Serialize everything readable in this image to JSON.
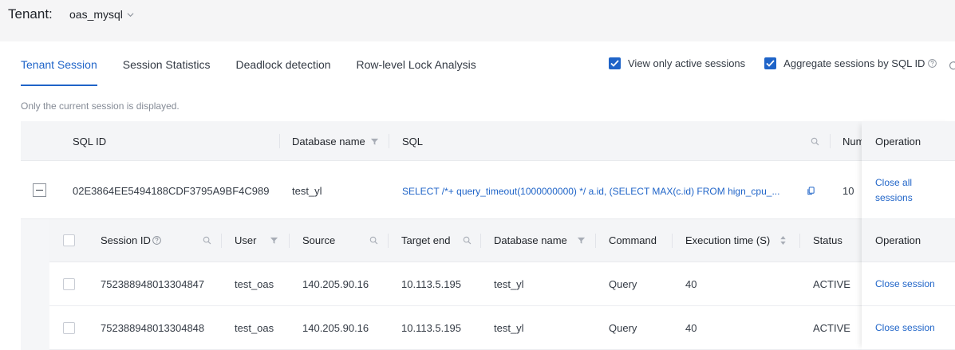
{
  "tenant": {
    "label": "Tenant:",
    "value": "oas_mysql"
  },
  "tabs": [
    {
      "label": "Tenant Session"
    },
    {
      "label": "Session Statistics"
    },
    {
      "label": "Deadlock detection"
    },
    {
      "label": "Row-level Lock Analysis"
    }
  ],
  "options": {
    "view_active": "View only active sessions",
    "aggregate": "Aggregate sessions by SQL ID"
  },
  "hint": "Only the current session is displayed.",
  "outer_table": {
    "headers": {
      "sql_id": "SQL ID",
      "database": "Database name",
      "sql": "SQL",
      "num": "Num",
      "operation": "Operation"
    },
    "row": {
      "sql_id": "02E3864EE5494188CDF3795A9BF4C989",
      "database": "test_yl",
      "sql": "SELECT /*+ query_timeout(1000000000) */ a.id, (SELECT MAX(c.id) FROM hign_cpu_...",
      "num": "10",
      "operation": "Close all sessions"
    }
  },
  "inner_table": {
    "headers": {
      "session_id": "Session ID",
      "user": "User",
      "source": "Source",
      "target": "Target end",
      "database": "Database name",
      "command": "Command",
      "exec_time": "Execution time (S)",
      "status": "Status",
      "operation": "Operation"
    },
    "rows": [
      {
        "session_id": "752388948013304847",
        "user": "test_oas",
        "source": "140.205.90.16",
        "target": "10.113.5.195",
        "database": "test_yl",
        "command": "Query",
        "exec_time": "40",
        "status": "ACTIVE",
        "operation": "Close session"
      },
      {
        "session_id": "752388948013304848",
        "user": "test_oas",
        "source": "140.205.90.16",
        "target": "10.113.5.195",
        "database": "test_yl",
        "command": "Query",
        "exec_time": "40",
        "status": "ACTIVE",
        "operation": "Close session"
      }
    ]
  },
  "colors": {
    "accent": "#1f64c8"
  },
  "icons": [
    "chevron-down-icon",
    "check-icon",
    "help-icon",
    "refresh-icon",
    "filter-icon",
    "search-icon",
    "copy-icon",
    "sort-icon",
    "minus-icon"
  ]
}
